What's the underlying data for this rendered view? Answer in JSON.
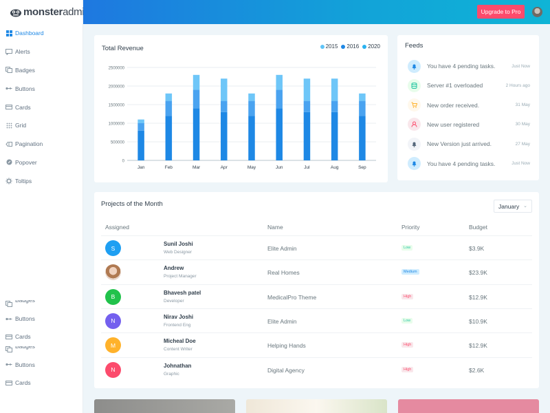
{
  "brand": {
    "bold": "monster",
    "light": "admin"
  },
  "sidebar": {
    "items": [
      {
        "label": "Dashboard",
        "icon": "grid-icon",
        "active": true
      },
      {
        "label": "Alerts",
        "icon": "message-icon"
      },
      {
        "label": "Badges",
        "icon": "copy-icon"
      },
      {
        "label": "Buttons",
        "icon": "toggle-icon"
      },
      {
        "label": "Cards",
        "icon": "card-icon"
      },
      {
        "label": "Grid",
        "icon": "dots-grid-icon"
      },
      {
        "label": "Pagination",
        "icon": "pagination-icon"
      },
      {
        "label": "Popover",
        "icon": "disc-icon"
      },
      {
        "label": "Toltips",
        "icon": "gear-icon"
      }
    ],
    "repeat_items": [
      {
        "label": "Badges",
        "icon": "copy-icon"
      },
      {
        "label": "Buttons",
        "icon": "toggle-icon"
      },
      {
        "label": "Cards",
        "icon": "card-icon"
      },
      {
        "label": "Badges",
        "icon": "copy-icon"
      },
      {
        "label": "Buttons",
        "icon": "toggle-icon"
      },
      {
        "label": "Cards",
        "icon": "card-icon"
      }
    ]
  },
  "topbar": {
    "upgrade_label": "Upgrade to Pro"
  },
  "revenue": {
    "title": "Total Revenue",
    "legend": [
      {
        "label": "2015",
        "color": "#5fc4f7"
      },
      {
        "label": "2016",
        "color": "#1e88e5"
      },
      {
        "label": "2020",
        "color": "#2ab2f0"
      }
    ]
  },
  "chart_data": {
    "type": "bar",
    "stacked": true,
    "title": "Total Revenue",
    "categories": [
      "Jan",
      "Feb",
      "Mar",
      "Apr",
      "May",
      "Jun",
      "Jul",
      "Aug",
      "Sep"
    ],
    "series": [
      {
        "name": "2015",
        "color": "#1e88e5",
        "values": [
          800000,
          1200000,
          1400000,
          1300000,
          1200000,
          1400000,
          1300000,
          1300000,
          1200000
        ]
      },
      {
        "name": "2016",
        "color": "#4aa3f0",
        "values": [
          200000,
          400000,
          500000,
          300000,
          400000,
          500000,
          300000,
          300000,
          400000
        ]
      },
      {
        "name": "2020",
        "color": "#6ec6f8",
        "values": [
          100000,
          200000,
          400000,
          600000,
          200000,
          400000,
          600000,
          600000,
          200000
        ]
      }
    ],
    "yticks": [
      "0",
      "500000",
      "1000000",
      "1500000",
      "2000000",
      "2500000"
    ],
    "ylim": [
      0,
      2500000
    ],
    "grid": true,
    "legend_position": "top-right"
  },
  "feeds": {
    "title": "Feeds",
    "items": [
      {
        "text": "You have 4 pending tasks.",
        "time": "Just Now",
        "icon": "bell-icon",
        "bg": "#cfecfe",
        "fg": "#1e88e5"
      },
      {
        "text": "Server #1 overloaded",
        "time": "2 Hours ago",
        "icon": "database-icon",
        "bg": "#e8fdeb",
        "fg": "#26c6a2"
      },
      {
        "text": "New order received.",
        "time": "31 May",
        "icon": "cart-icon",
        "bg": "#fff8ec",
        "fg": "#ffb22b"
      },
      {
        "text": "New user registered",
        "time": "30 May",
        "icon": "user-icon",
        "bg": "#f9e7eb",
        "fg": "#fc4b6c"
      },
      {
        "text": "New Version just arrived.",
        "time": "27 May",
        "icon": "bell-icon",
        "bg": "#f2f4f8",
        "fg": "#54667a"
      },
      {
        "text": "You have 4 pending tasks.",
        "time": "Just Now",
        "icon": "bell-icon",
        "bg": "#cfecfe",
        "fg": "#1e88e5"
      }
    ]
  },
  "projects": {
    "title": "Projects of the Month",
    "month": "January",
    "headers": {
      "assigned": "Assigned",
      "name": "Name",
      "priority": "Priority",
      "budget": "Budget"
    },
    "rows": [
      {
        "initial": "S",
        "color": "#1e9ff2",
        "name": "Sunil Joshi",
        "role": "Web Designer",
        "project": "Elite Admin",
        "priority": "Low",
        "level": "low",
        "budget": "$3.9K"
      },
      {
        "initial": "",
        "photo": true,
        "color": "#d8b9a6",
        "name": "Andrew",
        "role": "Project Manager",
        "project": "Real Homes",
        "priority": "Medium",
        "level": "medium",
        "budget": "$23.9K"
      },
      {
        "initial": "B",
        "color": "#21c24b",
        "name": "Bhavesh patel",
        "role": "Developer",
        "project": "MedicalPro Theme",
        "priority": "High",
        "level": "high",
        "budget": "$12.9K"
      },
      {
        "initial": "N",
        "color": "#7460ee",
        "name": "Nirav Joshi",
        "role": "Frontend Eng",
        "project": "Elite Admin",
        "priority": "Low",
        "level": "low",
        "budget": "$10.9K"
      },
      {
        "initial": "M",
        "color": "#ffb22b",
        "name": "Micheal Doe",
        "role": "Content Writer",
        "project": "Helping Hands",
        "priority": "High",
        "level": "high",
        "budget": "$12.9K"
      },
      {
        "initial": "N",
        "color": "#fc4b6c",
        "name": "Johnathan",
        "role": "Graphic",
        "project": "Digital Agency",
        "priority": "High",
        "level": "high",
        "budget": "$2.6K"
      }
    ]
  }
}
